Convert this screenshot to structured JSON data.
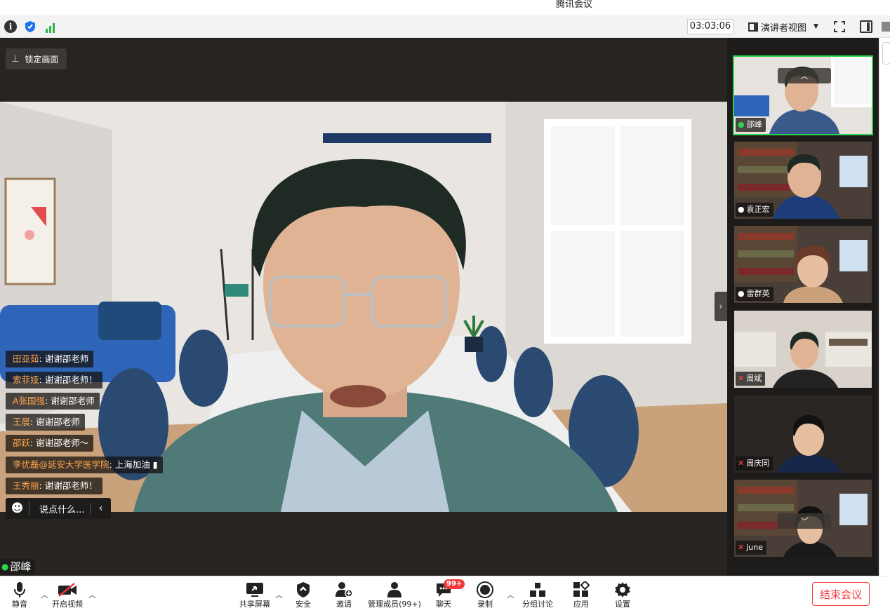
{
  "window": {
    "title": "腾讯会议"
  },
  "toolbar": {
    "timer": "03:03:06",
    "view_label": "演讲者视图",
    "icons": [
      "info-icon",
      "shield-icon",
      "signal-icon",
      "fullscreen-icon",
      "side-panel-icon"
    ]
  },
  "stage": {
    "lock_label": "锁定画面",
    "speaker_name": "邵峰"
  },
  "chat": {
    "messages": [
      {
        "name": "田亚茹",
        "text": "谢谢邵老师"
      },
      {
        "name": "索菲娅",
        "text": "谢谢邵老师！"
      },
      {
        "name": "A张国强",
        "text": "谢谢邵老师"
      },
      {
        "name": "王晨",
        "text": "谢谢邵老师"
      },
      {
        "name": "邵跃",
        "text": "谢谢邵老师～"
      },
      {
        "name": "李优磊@延安大学医学院",
        "text": "上海加油"
      },
      {
        "name": "王秀丽",
        "text": "谢谢邵老师！"
      }
    ],
    "input_placeholder": "说点什么..."
  },
  "participants": [
    {
      "name": "邵峰",
      "mic": "on",
      "active": true
    },
    {
      "name": "袁正宏",
      "mic": "off"
    },
    {
      "name": "雷群英",
      "mic": "off"
    },
    {
      "name": "周斌",
      "mic": "muted"
    },
    {
      "name": "周庆同",
      "mic": "muted"
    },
    {
      "name": "june",
      "mic": "muted"
    }
  ],
  "controls": {
    "mute": "静音",
    "video": "开启视频",
    "share": "共享屏幕",
    "security": "安全",
    "invite": "邀请",
    "members": "管理成员(99+)",
    "chat": "聊天",
    "chat_badge": "99+",
    "record": "录制",
    "breakout": "分组讨论",
    "apps": "应用",
    "settings": "设置",
    "end": "结束会议"
  },
  "colors": {
    "accent_green": "#2bd34f",
    "danger_red": "#f03b3b",
    "chat_name": "#ffa64d"
  }
}
